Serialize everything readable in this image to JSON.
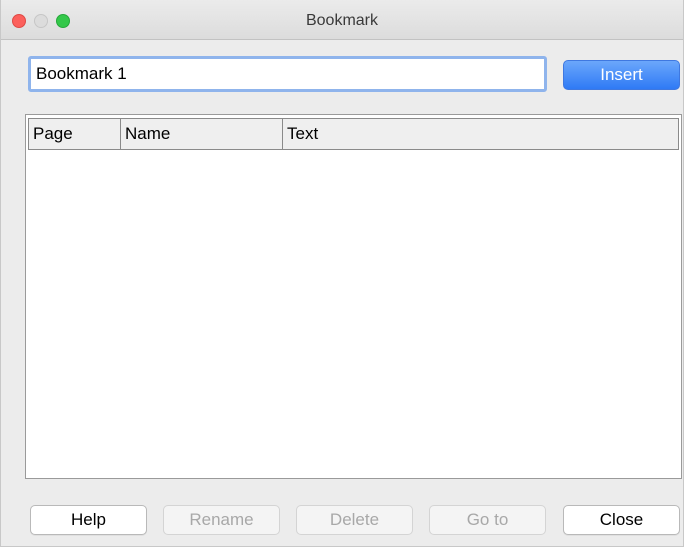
{
  "window": {
    "title": "Bookmark"
  },
  "bookmark": {
    "name_value": "Bookmark 1",
    "insert_label": "Insert"
  },
  "list": {
    "columns": [
      "Page",
      "Name",
      "Text"
    ],
    "rows": []
  },
  "buttons": {
    "help": {
      "label": "Help",
      "enabled": true
    },
    "rename": {
      "label": "Rename",
      "enabled": false
    },
    "delete": {
      "label": "Delete",
      "enabled": false
    },
    "goto": {
      "label": "Go to",
      "enabled": false
    },
    "close": {
      "label": "Close",
      "enabled": true
    }
  },
  "colors": {
    "accent": "#2f7af5",
    "focus_ring": "#8fb4ec",
    "close_light": "#fc605c",
    "zoom_light": "#34c84a"
  },
  "icons": [
    "close-window-icon",
    "minimize-window-icon",
    "zoom-window-icon"
  ]
}
